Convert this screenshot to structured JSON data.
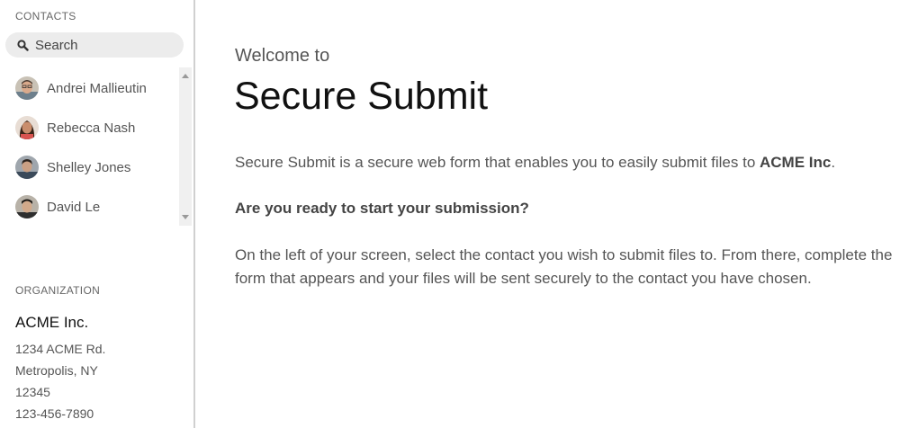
{
  "sidebar": {
    "contacts_heading": "CONTACTS",
    "search": {
      "placeholder": "Search",
      "value": ""
    },
    "contacts": [
      {
        "name": "Andrei Mallieutin",
        "avatar": "avatar-photo"
      },
      {
        "name": "Rebecca Nash",
        "avatar": "avatar-photo"
      },
      {
        "name": "Shelley Jones",
        "avatar": "avatar-photo"
      },
      {
        "name": "David Le",
        "avatar": "avatar-photo"
      }
    ],
    "organization_heading": "ORGANIZATION",
    "organization": {
      "name": "ACME Inc.",
      "address_line1": "1234 ACME Rd.",
      "city_state": "Metropolis, NY",
      "zip": "12345",
      "phone": "123-456-7890"
    }
  },
  "main": {
    "welcome": "Welcome to",
    "title": "Secure Submit",
    "intro_text": "Secure Submit is a secure web form that enables you to easily submit files to ",
    "intro_company": "ACME Inc",
    "intro_end": ".",
    "question": "Are you ready to start your submission?",
    "instructions": "On the left of your screen, select the contact you wish to submit files to. From there, complete the form that appears and your files will be sent securely to the contact you have chosen."
  },
  "colors": {
    "sidebar_border": "#d0d0d0",
    "search_bg": "#ececec",
    "text_muted": "#555555",
    "title": "#111111"
  }
}
